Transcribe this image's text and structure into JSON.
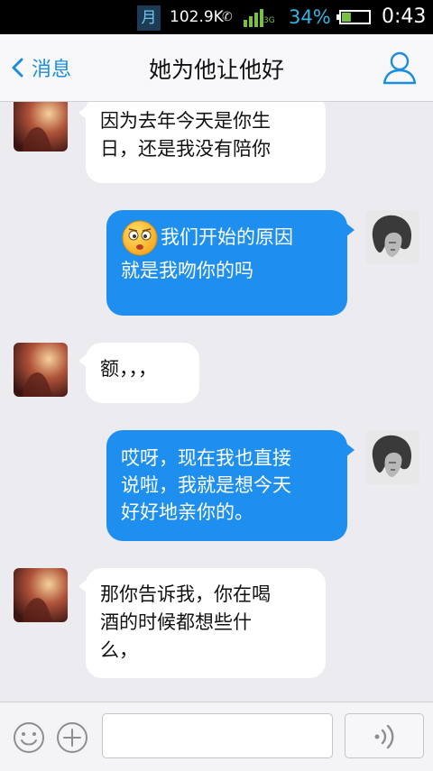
{
  "status_bar": {
    "moon_glyph": "月",
    "speed": "102.9K",
    "network_type": "3G",
    "battery_percent": "34%",
    "battery_level": 0.34,
    "time": "0:43"
  },
  "nav": {
    "back_label": "消息",
    "title": "她为他让他好"
  },
  "messages": [
    {
      "from": "contact",
      "text": "因为去年今天是你生\n日，还是我没有陪你"
    },
    {
      "from": "me",
      "emoji": "surprised-face-emoji",
      "text": "我们开始的原因\n就是我吻你的吗"
    },
    {
      "from": "contact",
      "text": "额，，，"
    },
    {
      "from": "me",
      "text": "哎呀，现在我也直接\n说啦，我就是想今天\n好好地亲你的。"
    },
    {
      "from": "contact",
      "text": "那你告诉我，你在喝\n酒的时候都想些什\n么，"
    }
  ],
  "input_bar": {
    "placeholder": ""
  },
  "colors": {
    "accent": "#1a8de0",
    "outgoing_bubble": "#1e8fee",
    "incoming_bubble": "#ffffff",
    "background": "#ecebf0"
  }
}
